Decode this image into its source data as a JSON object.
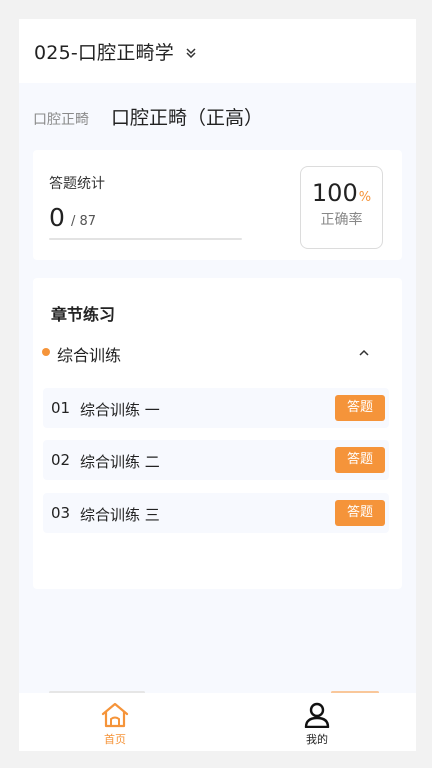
{
  "header": {
    "title": "025-口腔正畸学",
    "dropdown_icon": "chevron-double-down-icon"
  },
  "subject": {
    "category": "口腔正畸",
    "name": "口腔正畸（正高）"
  },
  "stats": {
    "label": "答题统计",
    "answered": "0",
    "total": "/ 87",
    "progress_fraction": 0,
    "rate_value": "100",
    "rate_unit": "%",
    "rate_label": "正确率"
  },
  "chapters": {
    "title": "章节练习",
    "group": {
      "name": "综合训练",
      "collapse_icon": "chevron-up-icon"
    },
    "items": [
      {
        "index": "01",
        "name": "综合训练 一",
        "action": "答题"
      },
      {
        "index": "02",
        "name": "综合训练 二",
        "action": "答题"
      },
      {
        "index": "03",
        "name": "综合训练 三",
        "action": "答题"
      }
    ]
  },
  "tabbar": {
    "home": {
      "label": "首页",
      "icon": "home-icon"
    },
    "mine": {
      "label": "我的",
      "icon": "user-icon"
    }
  },
  "colors": {
    "accent": "#f5943a",
    "background": "#f7f9fe",
    "card": "#ffffff"
  }
}
